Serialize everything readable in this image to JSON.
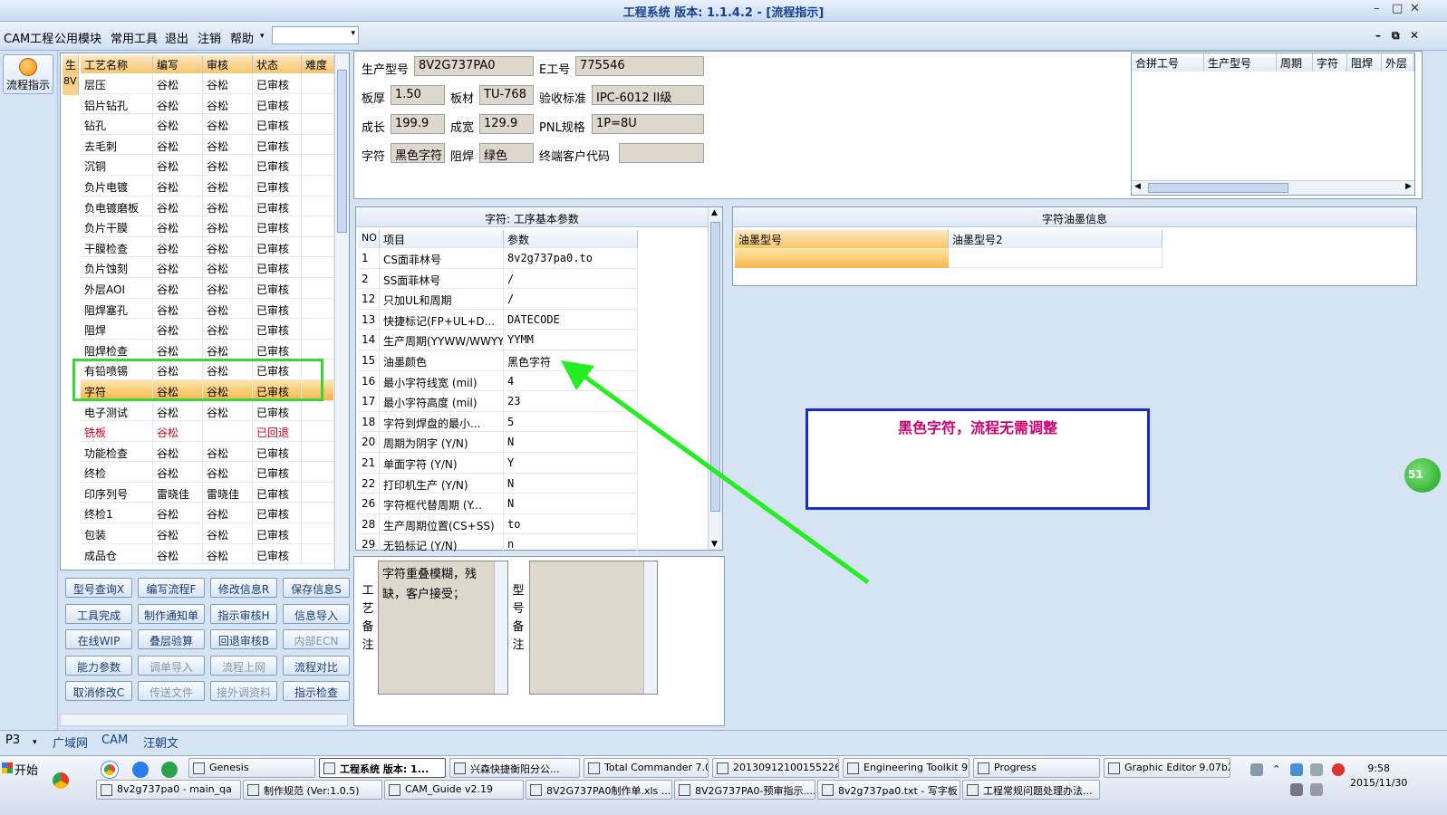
{
  "window": {
    "title": "工程系统   版本: 1.1.4.2 - [流程指示]",
    "controls": {
      "min": "–",
      "max": "□",
      "close": "✕"
    }
  },
  "menu": {
    "items": [
      "CAM工程",
      "公用模块",
      "常用工具",
      "退出",
      "注销",
      "帮助"
    ],
    "dropdown_arrow": "▾",
    "combo_value": "",
    "mdi_controls": {
      "min": "–",
      "restore": "⧉",
      "close": "✕"
    }
  },
  "left_toolbar": {
    "flow_button": "流程指示"
  },
  "process_list": {
    "stub_header": "生",
    "stub_first": "8V",
    "columns": [
      "工艺名称",
      "编写",
      "审核",
      "状态",
      "难度"
    ],
    "rows": [
      {
        "name": "层压",
        "writer": "谷松",
        "reviewer": "谷松",
        "status": "已审核",
        "difficulty": ""
      },
      {
        "name": "铝片钻孔",
        "writer": "谷松",
        "reviewer": "谷松",
        "status": "已审核",
        "difficulty": ""
      },
      {
        "name": "钻孔",
        "writer": "谷松",
        "reviewer": "谷松",
        "status": "已审核",
        "difficulty": ""
      },
      {
        "name": "去毛刺",
        "writer": "谷松",
        "reviewer": "谷松",
        "status": "已审核",
        "difficulty": ""
      },
      {
        "name": "沉铜",
        "writer": "谷松",
        "reviewer": "谷松",
        "status": "已审核",
        "difficulty": ""
      },
      {
        "name": "负片电镀",
        "writer": "谷松",
        "reviewer": "谷松",
        "status": "已审核",
        "difficulty": ""
      },
      {
        "name": "负电镀磨板",
        "writer": "谷松",
        "reviewer": "谷松",
        "status": "已审核",
        "difficulty": ""
      },
      {
        "name": "负片干膜",
        "writer": "谷松",
        "reviewer": "谷松",
        "status": "已审核",
        "difficulty": ""
      },
      {
        "name": "干膜检查",
        "writer": "谷松",
        "reviewer": "谷松",
        "status": "已审核",
        "difficulty": ""
      },
      {
        "name": "负片蚀刻",
        "writer": "谷松",
        "reviewer": "谷松",
        "status": "已审核",
        "difficulty": ""
      },
      {
        "name": "外层AOI",
        "writer": "谷松",
        "reviewer": "谷松",
        "status": "已审核",
        "difficulty": ""
      },
      {
        "name": "阻焊塞孔",
        "writer": "谷松",
        "reviewer": "谷松",
        "status": "已审核",
        "difficulty": ""
      },
      {
        "name": "阻焊",
        "writer": "谷松",
        "reviewer": "谷松",
        "status": "已审核",
        "difficulty": ""
      },
      {
        "name": "阻焊检查",
        "writer": "谷松",
        "reviewer": "谷松",
        "status": "已审核",
        "difficulty": ""
      },
      {
        "name": "有铅喷锡",
        "writer": "谷松",
        "reviewer": "谷松",
        "status": "已审核",
        "difficulty": ""
      },
      {
        "name": "字符",
        "writer": "谷松",
        "reviewer": "谷松",
        "status": "已审核",
        "difficulty": ""
      },
      {
        "name": "电子测试",
        "writer": "谷松",
        "reviewer": "谷松",
        "status": "已审核",
        "difficulty": ""
      },
      {
        "name": "铣板",
        "writer": "谷松",
        "reviewer": "",
        "status": "已回退",
        "difficulty": ""
      },
      {
        "name": "功能检查",
        "writer": "谷松",
        "reviewer": "谷松",
        "status": "已审核",
        "difficulty": ""
      },
      {
        "name": "终检",
        "writer": "谷松",
        "reviewer": "谷松",
        "status": "已审核",
        "difficulty": ""
      },
      {
        "name": "印序列号",
        "writer": "雷晓佳",
        "reviewer": "雷晓佳",
        "status": "已审核",
        "difficulty": ""
      },
      {
        "name": "终检1",
        "writer": "谷松",
        "reviewer": "谷松",
        "status": "已审核",
        "difficulty": ""
      },
      {
        "name": "包装",
        "writer": "谷松",
        "reviewer": "谷松",
        "status": "已审核",
        "difficulty": ""
      },
      {
        "name": "成品仓",
        "writer": "谷松",
        "reviewer": "谷松",
        "status": "已审核",
        "difficulty": ""
      }
    ]
  },
  "buttons": [
    [
      "型号查询X",
      "编写流程F",
      "修改信息R",
      "保存信息S"
    ],
    [
      "工具完成",
      "制作通知单",
      "指示审核H",
      "信息导入"
    ],
    [
      "在线WIP",
      "叠层验算",
      "回退审核B",
      "内部ECN"
    ],
    [
      "能力参数",
      "调单导入",
      "流程上网",
      "流程对比"
    ],
    [
      "取消修改C",
      "传送文件",
      "接外调资料",
      "指示检查"
    ]
  ],
  "info": {
    "model_label": "生产型号",
    "model": "8V2G737PA0",
    "eno_label": "E工号",
    "eno": "775546",
    "thickness_label": "板厚",
    "thickness": "1.50",
    "material_label": "板材",
    "material": "TU-768",
    "standard_label": "验收标准",
    "standard": "IPC-6012 II级",
    "length_label": "成长",
    "length": "199.9",
    "width_label": "成宽",
    "width": "129.9",
    "pnl_label": "PNL规格",
    "pnl": "1P=8U",
    "char_label": "字符",
    "char": "黑色字符",
    "mask_label": "阻焊",
    "mask": "绿色",
    "customer_label": "终端客户代码",
    "customer": ""
  },
  "merge_grid": {
    "columns": [
      "合拼工号",
      "生产型号",
      "周期",
      "字符",
      "阻焊",
      "外层"
    ]
  },
  "params": {
    "title": "字符: 工序基本参数",
    "columns": [
      "NO",
      "项目",
      "参数"
    ],
    "rows": [
      {
        "no": "1",
        "item": "CS面菲林号",
        "value": "8v2g737pa0.to"
      },
      {
        "no": "2",
        "item": "SS面菲林号",
        "value": "/"
      },
      {
        "no": "12",
        "item": "只加UL和周期",
        "value": "/"
      },
      {
        "no": "13",
        "item": "快捷标记(FP+UL+D...",
        "value": "DATECODE"
      },
      {
        "no": "14",
        "item": "生产周期(YYWW/WWYY)",
        "value": "YYMM"
      },
      {
        "no": "15",
        "item": "油墨颜色",
        "value": "黑色字符"
      },
      {
        "no": "16",
        "item": "最小字符线宽 (mil)",
        "value": "4"
      },
      {
        "no": "17",
        "item": "最小字符高度 (mil)",
        "value": "23"
      },
      {
        "no": "18",
        "item": "字符到焊盘的最小...",
        "value": "5"
      },
      {
        "no": "20",
        "item": "周期为阴字 (Y/N)",
        "value": "N"
      },
      {
        "no": "21",
        "item": "单面字符 (Y/N)",
        "value": "Y"
      },
      {
        "no": "22",
        "item": "打印机生产 (Y/N)",
        "value": "N"
      },
      {
        "no": "26",
        "item": "字符框代替周期 (Y...",
        "value": "N"
      },
      {
        "no": "28",
        "item": "生产周期位置(CS+SS)",
        "value": "to"
      },
      {
        "no": "29",
        "item": "无铅标记 (Y/N)",
        "value": "n"
      }
    ]
  },
  "notes": {
    "process_label": "工艺备注",
    "process_text": "字符重叠模糊，残缺，客户接受；",
    "model_label": "型号备注",
    "model_text": ""
  },
  "ink": {
    "title": "字符油墨信息",
    "columns": [
      "油墨型号",
      "油墨型号2"
    ]
  },
  "annotation": {
    "text": "黑色字符，流程无需调整"
  },
  "side_bubble": "51",
  "tabs": {
    "left": "P3",
    "items": [
      "广域网",
      "CAM",
      "汪朝文"
    ]
  },
  "taskbar": {
    "start": "开始",
    "row1": [
      "Genesis",
      "工程系统  版本: 1...",
      "兴森快捷衡阳分公...",
      "Total Commander 7.0...",
      "20130912100155226...",
      "Engineering Toolkit 9....",
      "Progress",
      "Graphic Editor 9.07b2..."
    ],
    "row2": [
      "8v2g737pa0 - main_qa",
      "制作规范 (Ver:1.0.5)",
      "CAM_Guide v2.19",
      "8V2G737PA0制作单.xls ...",
      "8V2G737PA0-预审指示....",
      "8v2g737pa0.txt - 写字板",
      "工程常规问题处理办法..."
    ],
    "clock_time": "9:58",
    "clock_date": "2015/11/30"
  },
  "colors": {
    "highlight_green": "#3bd43b",
    "annotation_border": "#1c2bd0",
    "annotation_text": "#d1006f",
    "arrow": "#22ee22"
  }
}
